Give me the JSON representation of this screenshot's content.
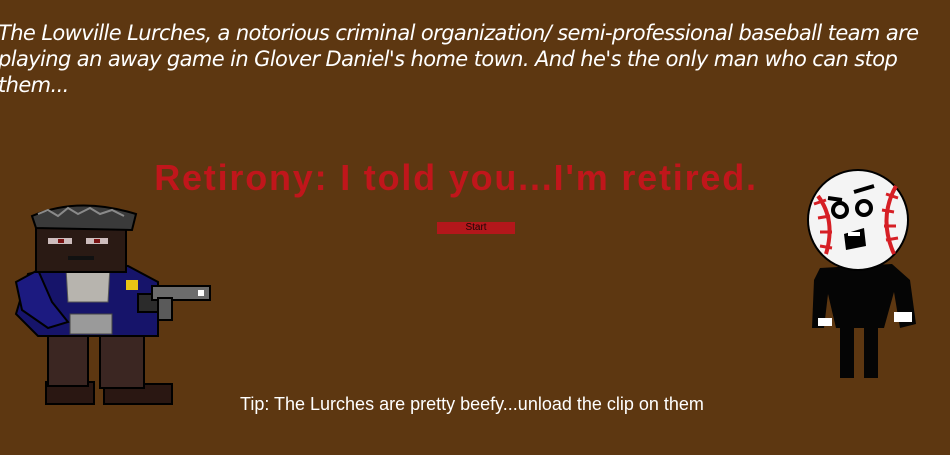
{
  "intro_text": "The Lowville Lurches, a notorious criminal organization/ semi-professional baseball team are playing an away game in Glover Daniel's home town. And he's the only man who can stop them...",
  "title": "Retirony: I told you...I'm retired.",
  "start_button": {
    "label": "Start",
    "color": "#b3171b"
  },
  "tip": "Tip: The Lurches are pretty beefy...unload the clip on them",
  "characters": {
    "player": "glover-daniel-sprite",
    "enemy": "lurch-baseball-head-sprite"
  },
  "colors": {
    "background": "#5d3711",
    "title": "#c0161b",
    "text": "#ffffff"
  }
}
